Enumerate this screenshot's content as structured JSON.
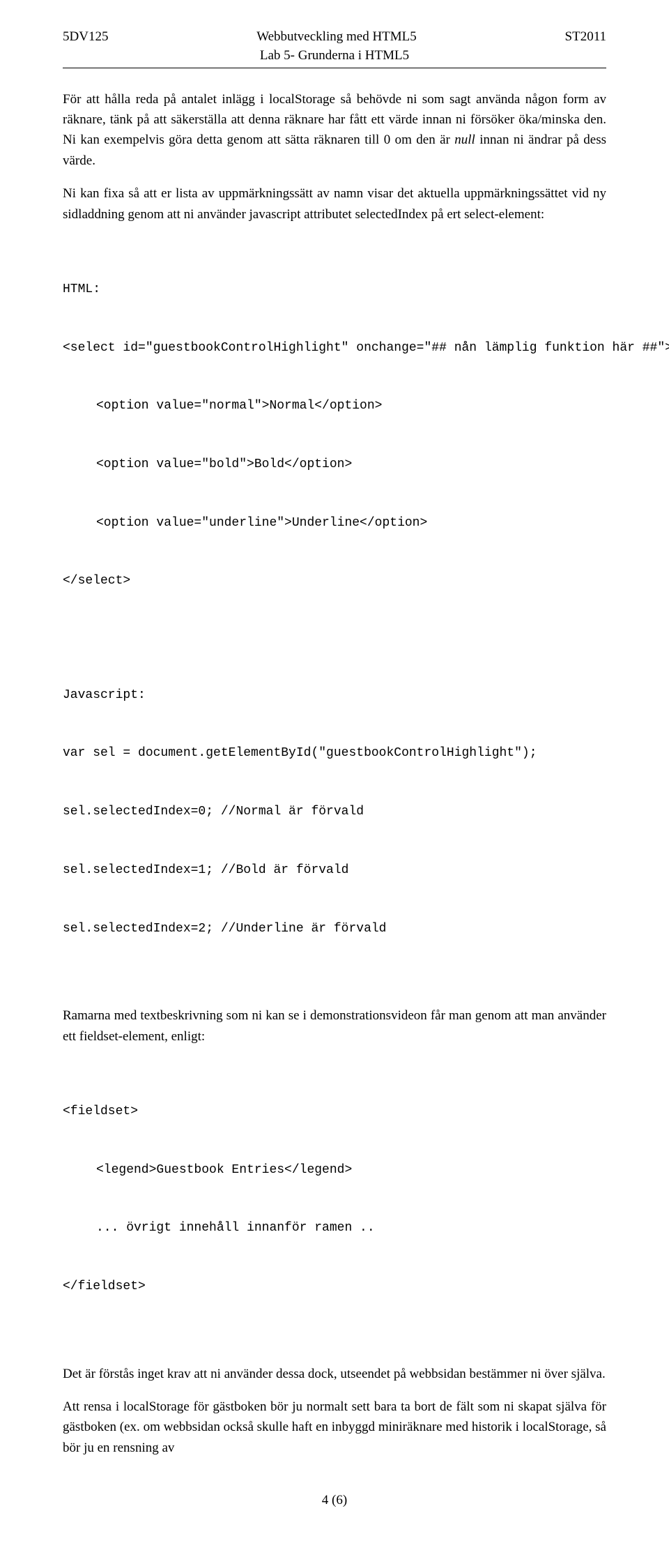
{
  "header": {
    "left": "5DV125",
    "center": "Webbutveckling med HTML5",
    "right": "ST2011",
    "sub": "Lab 5- Grunderna i HTML5"
  },
  "p1_a": "För att hålla reda på antalet inlägg i localStorage så behövde ni som sagt använda någon form av räknare, tänk på att säkerställa att denna räknare har fått ett värde innan ni försöker öka/minska den. Ni kan exempelvis göra detta genom att sätta räknaren till 0 om den är ",
  "p1_null": "null",
  "p1_b": " innan ni ändrar på dess värde.",
  "p2": "Ni kan fixa så att er lista av uppmärkningssätt av namn visar det aktuella uppmärkningssättet vid ny sidladdning genom att ni använder javascript attributet selectedIndex på ert select-element:",
  "code1": {
    "l1": "HTML:",
    "l2": "<select id=\"guestbookControlHighlight\" onchange=\"## nån lämplig funktion här ##\">",
    "l3": "<option value=\"normal\">Normal</option>",
    "l4": "<option value=\"bold\">Bold</option>",
    "l5": "<option value=\"underline\">Underline</option>",
    "l6": "</select>"
  },
  "code2": {
    "l1": "Javascript:",
    "l2": "var sel = document.getElementById(\"guestbookControlHighlight\");",
    "l3": "sel.selectedIndex=0; //Normal är förvald",
    "l4": "sel.selectedIndex=1; //Bold är förvald",
    "l5": "sel.selectedIndex=2; //Underline är förvald"
  },
  "p3": "Ramarna med textbeskrivning som ni kan se i demonstrationsvideon får man genom att man använder ett fieldset-element, enligt:",
  "code3": {
    "l1": "<fieldset>",
    "l2": "<legend>Guestbook Entries</legend>",
    "l3": "... övrigt innehåll innanför ramen ..",
    "l4": "</fieldset>"
  },
  "p4": "Det är förstås inget krav att ni använder dessa dock, utseendet på webbsidan bestämmer ni över själva.",
  "p5": "Att rensa i localStorage för gästboken bör ju normalt sett bara ta bort de fält som ni skapat själva för gästboken (ex. om webbsidan också skulle haft en inbyggd miniräknare med historik i localStorage, så bör ju en rensning av",
  "footer": "4 (6)"
}
